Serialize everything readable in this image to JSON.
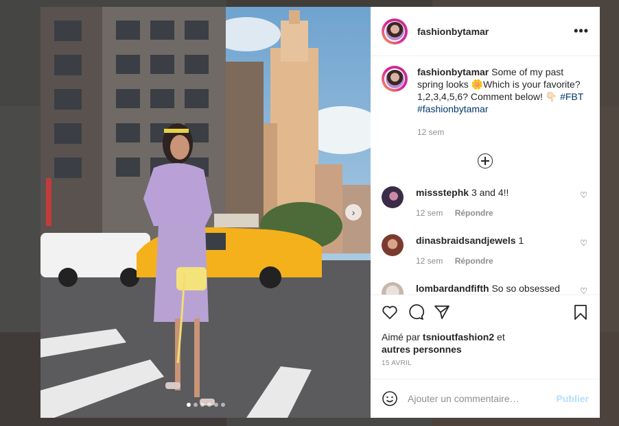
{
  "post": {
    "username": "fashionbytamar",
    "caption_text": "Some of my past spring looks 🌼Which is your favorite? 1,2,3,4,5,6? Comment below! 👇🏻",
    "hashtags": [
      "#FBT",
      "#fashionbytamar"
    ],
    "caption_time": "12 sem",
    "likes_prefix": "Aimé par",
    "likes_user": "tsnioutfashion2",
    "likes_suffix": "et",
    "likes_others": "autres personnes",
    "date": "15 AVRIL"
  },
  "comments": [
    {
      "user": "missstephk",
      "text": "3 and 4!!",
      "time": "12 sem",
      "reply": "Répondre"
    },
    {
      "user": "dinasbraidsandjewels",
      "text": "1",
      "time": "12 sem",
      "reply": "Répondre"
    },
    {
      "user": "lombardandfifth",
      "text": "So so obsessed",
      "time": "",
      "reply": ""
    }
  ],
  "composer": {
    "placeholder": "Ajouter un commentaire…",
    "post_label": "Publier"
  },
  "icons": {
    "more": "more-options-icon",
    "load_more": "plus-circle-icon",
    "like": "heart-icon",
    "comment": "comment-bubble-icon",
    "share": "paper-plane-icon",
    "save": "bookmark-icon",
    "emoji": "smiley-icon",
    "next": "chevron-right-icon",
    "comment_like": "small-heart-icon"
  },
  "carousel": {
    "total": 6,
    "active": 1
  },
  "colors": {
    "link": "#00376b",
    "muted": "#8e8e8e",
    "post_disabled": "#b2dffc"
  }
}
